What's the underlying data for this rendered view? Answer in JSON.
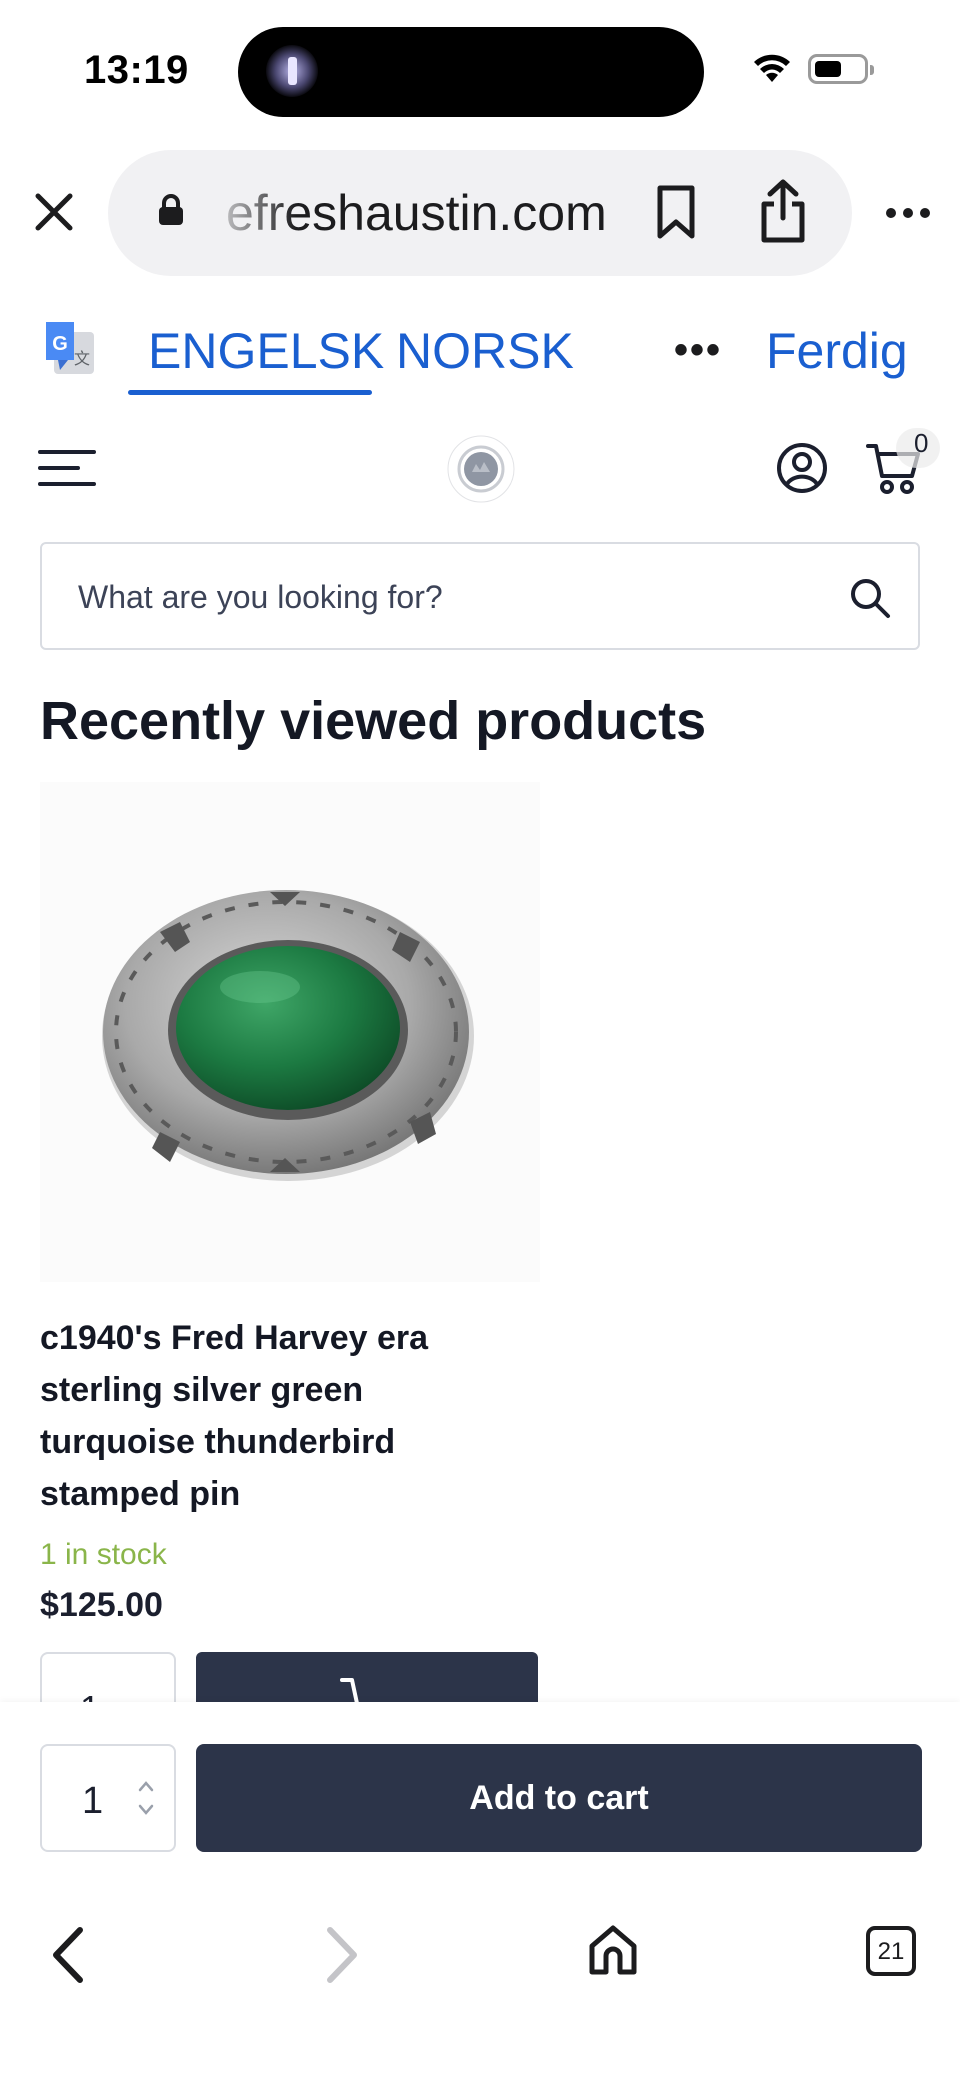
{
  "status_bar": {
    "time": "13:19"
  },
  "browser": {
    "url": "efreshaustin.com",
    "icons": [
      "close-icon",
      "lock-icon",
      "bookmark-icon",
      "share-icon",
      "more-icon"
    ]
  },
  "translate_bar": {
    "source_language": "ENGELSK",
    "target_language": "NORSK",
    "more_label": "•••",
    "done_label": "Ferdig"
  },
  "site_header": {
    "cart_count": "0"
  },
  "search": {
    "placeholder": "What are you looking for?"
  },
  "section": {
    "title": "Recently viewed products"
  },
  "product": {
    "title": "c1940's Fred Harvey era sterling silver green turquoise thunderbird stamped pin",
    "stock": "1 in stock",
    "price": "$125.00",
    "inline_quantity": "1"
  },
  "sticky_cart": {
    "quantity": "1",
    "button_label": "Add to cart"
  },
  "bottom_toolbar": {
    "tab_count": "21"
  },
  "colors": {
    "accent_blue": "#1a5fd0",
    "button_navy": "#2c3449",
    "stock_green": "#8ab54a"
  }
}
